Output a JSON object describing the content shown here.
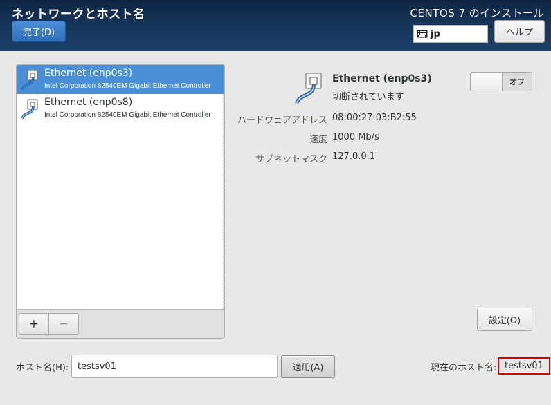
{
  "header": {
    "page_title": "ネットワークとホスト名",
    "done_label": "完了(D)",
    "product_title": "CENTOS 7 のインストール",
    "keyboard_layout": "jp",
    "help_label": "ヘルプ",
    "colors": {
      "header_bg": "#17365c",
      "done_button": "#3a7dc9"
    }
  },
  "device_list": {
    "items": [
      {
        "name": "Ethernet (enp0s3)",
        "description": "Intel Corporation 82540EM Gigabit Ethernet Controller",
        "selected": true,
        "icon": "ethernet-cable-icon"
      },
      {
        "name": "Ethernet (enp0s8)",
        "description": "Intel Corporation 82540EM Gigabit Ethernet Controller",
        "selected": false,
        "icon": "ethernet-cable-icon"
      }
    ],
    "add_label": "+",
    "remove_label": "−",
    "selection_color": "#4a90d9"
  },
  "detail": {
    "name": "Ethernet (enp0s3)",
    "status": "切断されています",
    "toggle_label": "オフ",
    "toggle_on": false,
    "icon": "ethernet-cable-icon",
    "properties": [
      {
        "key": "ハードウェアアドレス",
        "value": "08:00:27:03:B2:55"
      },
      {
        "key": "速度",
        "value": "1000 Mb/s"
      },
      {
        "key": "サブネットマスク",
        "value": "127.0.0.1"
      }
    ],
    "settings_label": "設定(O)"
  },
  "hostname": {
    "label": "ホスト名(H):",
    "value": "testsv01",
    "apply_label": "適用(A)",
    "current_label": "現在のホスト名:",
    "current_value": "testsv01",
    "highlight_color": "#d40000"
  }
}
